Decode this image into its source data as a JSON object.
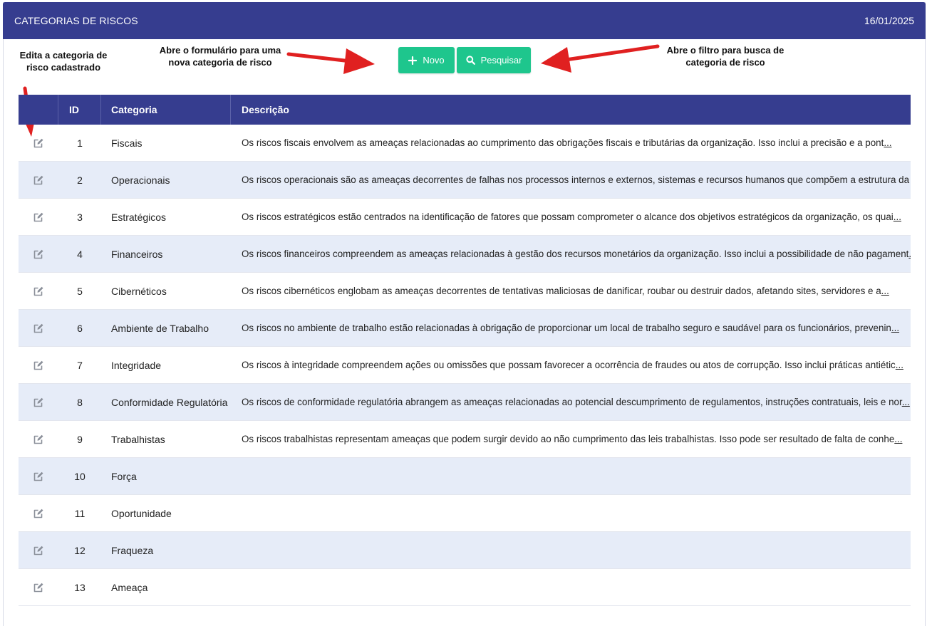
{
  "header": {
    "title": "CATEGORIAS DE RISCOS",
    "date": "16/01/2025"
  },
  "annotations": {
    "edit": "Edita a categoria de risco cadastrado",
    "novo": "Abre o formulário para uma nova categoria de risco",
    "pesquisar": "Abre o filtro para busca de categoria de risco"
  },
  "toolbar": {
    "novo_label": "Novo",
    "pesquisar_label": "Pesquisar"
  },
  "table": {
    "headers": {
      "id": "ID",
      "categoria": "Categoria",
      "descricao": "Descrição"
    },
    "rows": [
      {
        "id": "1",
        "categoria": "Fiscais",
        "descricao": "Os riscos fiscais envolvem as ameaças relacionadas ao cumprimento das obrigações fiscais e tributárias da organização. Isso inclui a precisão e a pont",
        "more": "..."
      },
      {
        "id": "2",
        "categoria": "Operacionais",
        "descricao": "Os riscos operacionais são as ameaças decorrentes de falhas nos processos internos e externos, sistemas e recursos humanos que compõem a estrutura da ",
        "more": "..."
      },
      {
        "id": "3",
        "categoria": "Estratégicos",
        "descricao": "Os riscos estratégicos estão centrados na identificação de fatores que possam comprometer o alcance dos objetivos estratégicos da organização, os quai",
        "more": "..."
      },
      {
        "id": "4",
        "categoria": "Financeiros",
        "descricao": "Os riscos financeiros compreendem as ameaças relacionadas à gestão dos recursos monetários da organização. Isso inclui a possibilidade de não pagament",
        "more": "..."
      },
      {
        "id": "5",
        "categoria": "Cibernéticos",
        "descricao": "Os riscos cibernéticos englobam as ameaças decorrentes de tentativas maliciosas de danificar, roubar ou destruir dados, afetando sites, servidores e a",
        "more": "..."
      },
      {
        "id": "6",
        "categoria": "Ambiente de Trabalho",
        "descricao": "Os riscos no ambiente de trabalho estão relacionadas à obrigação de proporcionar um local de trabalho seguro e saudável para os funcionários, prevenin",
        "more": "..."
      },
      {
        "id": "7",
        "categoria": "Integridade",
        "descricao": "Os riscos à integridade compreendem ações ou omissões que possam favorecer a ocorrência de fraudes ou atos de corrupção. Isso inclui práticas antiétic",
        "more": "..."
      },
      {
        "id": "8",
        "categoria": "Conformidade Regulatória",
        "descricao": "Os riscos de conformidade regulatória abrangem as ameaças relacionadas ao potencial descumprimento de regulamentos, instruções contratuais, leis e nor",
        "more": "..."
      },
      {
        "id": "9",
        "categoria": "Trabalhistas",
        "descricao": "Os riscos trabalhistas representam ameaças que podem surgir devido ao não cumprimento das leis trabalhistas. Isso pode ser resultado de falta de conhe",
        "more": "..."
      },
      {
        "id": "10",
        "categoria": "Força",
        "descricao": "",
        "more": ""
      },
      {
        "id": "11",
        "categoria": "Oportunidade",
        "descricao": "",
        "more": ""
      },
      {
        "id": "12",
        "categoria": "Fraqueza",
        "descricao": "",
        "more": ""
      },
      {
        "id": "13",
        "categoria": "Ameaça",
        "descricao": "",
        "more": ""
      }
    ]
  },
  "icons": {
    "edit": "edit-icon",
    "plus": "plus-icon",
    "search": "search-icon"
  },
  "colors": {
    "header": "#363d8f",
    "button": "#1ec68d",
    "alt_row": "#e6ecf8",
    "arrow": "#e02020"
  }
}
